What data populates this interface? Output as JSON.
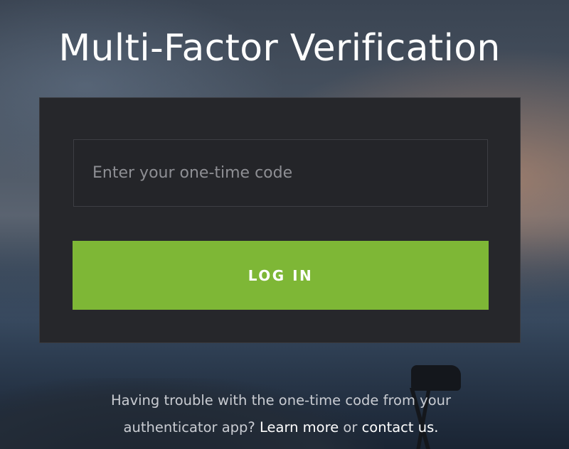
{
  "title": "Multi-Factor Verification",
  "form": {
    "code_placeholder": "Enter your one-time code",
    "code_value": "",
    "login_label": "LOG IN"
  },
  "help": {
    "text_part1": "Having trouble with the one-time code from your authenticator app? ",
    "learn_more_label": "Learn more",
    "text_part2": " or ",
    "contact_label": "contact us."
  },
  "colors": {
    "accent": "#7eb736",
    "card_background": "#26272b",
    "title_text": "#ffffff"
  }
}
